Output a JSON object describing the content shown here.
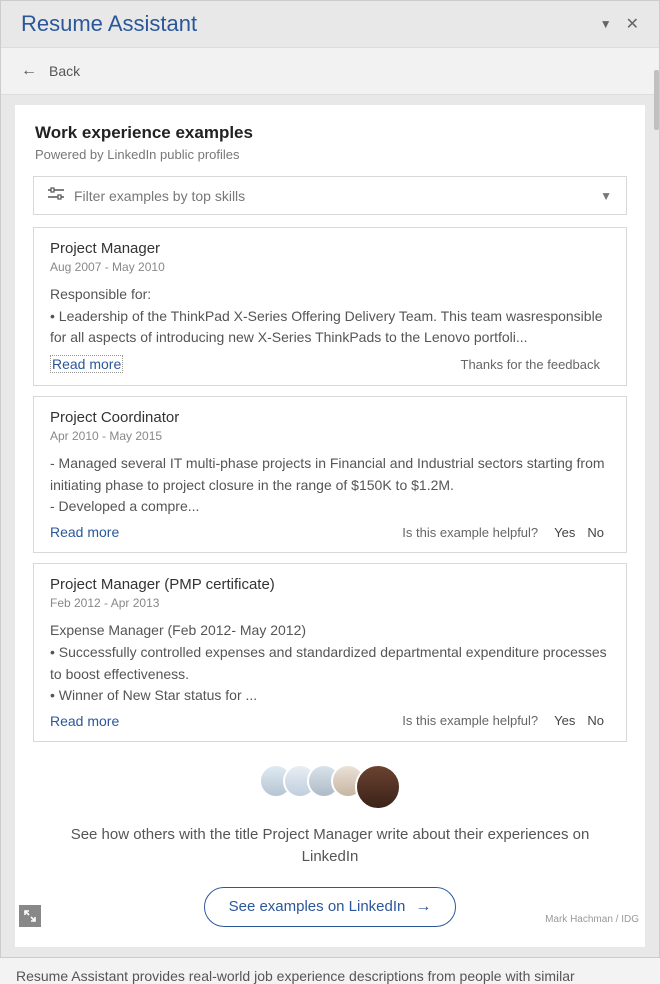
{
  "titlebar": {
    "title": "Resume Assistant"
  },
  "toolbar": {
    "back_label": "Back"
  },
  "section": {
    "heading": "Work experience examples",
    "subtitle": "Powered by LinkedIn public profiles"
  },
  "filter": {
    "label": "Filter examples by top skills"
  },
  "cards": [
    {
      "title": "Project Manager",
      "dates": "Aug 2007 - May 2010",
      "body": "Responsible for:\n• Leadership of the ThinkPad X-Series Offering Delivery Team. This team wasresponsible for all aspects of introducing new X-Series ThinkPads to the Lenovo portfoli...",
      "read_more": "Read more",
      "feedback_text": "Thanks for the feedback",
      "show_yesno": false,
      "read_more_dotted": true
    },
    {
      "title": "Project Coordinator",
      "dates": "Apr 2010 - May 2015",
      "body": "- Managed several IT multi-phase projects in Financial and Industrial sectors starting from initiating phase to project closure in the range of $150K to $1.2M.\n- Developed a compre...",
      "read_more": "Read more",
      "feedback_text": "Is this example helpful?",
      "show_yesno": true,
      "read_more_dotted": false
    },
    {
      "title": "Project Manager (PMP certificate)",
      "dates": "Feb 2012 - Apr 2013",
      "body": "Expense Manager (Feb 2012- May 2012)\n• Successfully controlled expenses and standardized departmental expenditure processes to boost effectiveness.\n• Winner of New Star status for ...",
      "read_more": "Read more",
      "feedback_text": "Is this example helpful?",
      "show_yesno": true,
      "read_more_dotted": false
    }
  ],
  "feedback": {
    "yes": "Yes",
    "no": "No"
  },
  "promo": {
    "text": "See how others with the title Project Manager write about their experiences on LinkedIn",
    "cta": "See examples on LinkedIn"
  },
  "credit": "Mark Hachman / IDG",
  "caption": "Resume Assistant provides real-world job experience descriptions from people with similar"
}
